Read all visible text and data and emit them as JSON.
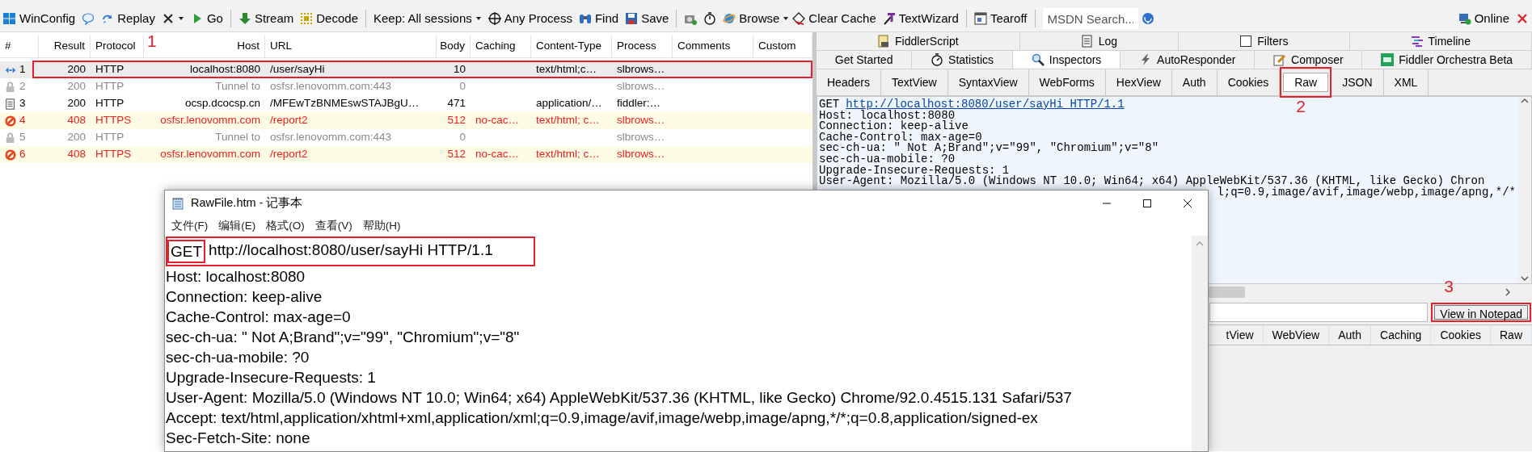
{
  "toolbar": {
    "items": [
      {
        "kind": "button",
        "label": "WinConfig"
      },
      {
        "kind": "icon"
      },
      {
        "kind": "button",
        "label": "Replay"
      },
      {
        "kind": "icon_dropdown"
      },
      {
        "kind": "button",
        "label": "Go"
      },
      {
        "kind": "separator"
      },
      {
        "kind": "button",
        "label": "Stream"
      },
      {
        "kind": "button",
        "label": "Decode"
      },
      {
        "kind": "separator"
      },
      {
        "kind": "dropdown",
        "label": "Keep: All sessions"
      },
      {
        "kind": "button",
        "label": "Any Process"
      },
      {
        "kind": "button",
        "label": "Find"
      },
      {
        "kind": "button",
        "label": "Save"
      },
      {
        "kind": "separator"
      },
      {
        "kind": "icon"
      },
      {
        "kind": "icon"
      },
      {
        "kind": "button_dropdown",
        "label": "Browse"
      },
      {
        "kind": "button",
        "label": "Clear Cache"
      },
      {
        "kind": "button",
        "label": "TextWizard"
      },
      {
        "kind": "separator"
      },
      {
        "kind": "button",
        "label": "Tearoff"
      },
      {
        "kind": "separator"
      },
      {
        "kind": "search",
        "placeholder": "MSDN Search..."
      },
      {
        "kind": "icon"
      },
      {
        "kind": "status",
        "label": "Online"
      },
      {
        "kind": "close"
      }
    ]
  },
  "sessions": {
    "columns": [
      "#",
      "Result",
      "Protocol",
      "Host",
      "URL",
      "Body",
      "Caching",
      "Content-Type",
      "Process",
      "Comments",
      "Custom"
    ],
    "rows": [
      {
        "kind": "request",
        "selected": true,
        "annotated": true,
        "callout": "1",
        "number": "1",
        "result": "200",
        "protocol": "HTTP",
        "host": "localhost:8080",
        "url": "/user/sayHi",
        "body": "10",
        "content_type": "text/html;c…",
        "process": "slbrows…"
      },
      {
        "kind": "tunnel",
        "selected": false,
        "annotated": false,
        "number": "2",
        "result": "200",
        "protocol": "HTTP",
        "host": "Tunnel to",
        "url": "osfsr.lenovomm.com:443",
        "body": "0",
        "process": "slbrows…"
      },
      {
        "kind": "document",
        "selected": false,
        "annotated": false,
        "number": "3",
        "result": "200",
        "protocol": "HTTP",
        "host": "ocsp.dcocsp.cn",
        "url": "/MFEwTzBNMEswSTAJBgU…",
        "body": "471",
        "content_type": "application/…",
        "process": "fiddler:…"
      },
      {
        "kind": "error",
        "selected": false,
        "annotated": false,
        "number": "4",
        "result": "408",
        "protocol": "HTTPS",
        "host": "osfsr.lenovomm.com",
        "url": "/report2",
        "body": "512",
        "caching": "no-cac…",
        "content_type": "text/html; c…",
        "process": "slbrows…"
      },
      {
        "kind": "tunnel",
        "selected": false,
        "annotated": false,
        "number": "5",
        "result": "200",
        "protocol": "HTTP",
        "host": "Tunnel to",
        "url": "osfsr.lenovomm.com:443",
        "body": "0",
        "process": "slbrows…"
      },
      {
        "kind": "error",
        "selected": false,
        "annotated": false,
        "number": "6",
        "result": "408",
        "protocol": "HTTPS",
        "host": "osfsr.lenovomm.com",
        "url": "/report2",
        "body": "512",
        "caching": "no-cac…",
        "content_type": "text/html; c…",
        "process": "slbrows…"
      }
    ]
  },
  "inspector": {
    "top_tabs": [
      {
        "label": "FiddlerScript"
      },
      {
        "label": "Log"
      },
      {
        "label": "Filters"
      },
      {
        "label": "Timeline"
      }
    ],
    "main_tabs": [
      {
        "label": "Get Started",
        "selected": false
      },
      {
        "label": "Statistics",
        "selected": false
      },
      {
        "label": "Inspectors",
        "selected": true
      },
      {
        "label": "AutoResponder",
        "selected": false
      },
      {
        "label": "Composer",
        "selected": false
      },
      {
        "label": "Fiddler Orchestra Beta",
        "selected": false
      }
    ],
    "request_tabs": [
      {
        "label": "Headers",
        "selected": false,
        "annotated": false
      },
      {
        "label": "TextView",
        "selected": false,
        "annotated": false
      },
      {
        "label": "SyntaxView",
        "selected": false,
        "annotated": false
      },
      {
        "label": "WebForms",
        "selected": false,
        "annotated": false
      },
      {
        "label": "HexView",
        "selected": false,
        "annotated": false
      },
      {
        "label": "Auth",
        "selected": false,
        "annotated": false
      },
      {
        "label": "Cookies",
        "selected": false,
        "annotated": false
      },
      {
        "label": "Raw",
        "selected": true,
        "annotated": true,
        "callout": "2"
      },
      {
        "label": "JSON",
        "selected": false,
        "annotated": false
      },
      {
        "label": "XML",
        "selected": false,
        "annotated": false
      }
    ],
    "raw": {
      "method": "GET",
      "link": "http://localhost:8080/user/sayHi HTTP/1.1",
      "lines": [
        "Host: localhost:8080",
        "Connection: keep-alive",
        "Cache-Control: max-age=0",
        "sec-ch-ua: \" Not A;Brand\";v=\"99\", \"Chromium\";v=\"8\"",
        "sec-ch-ua-mobile: ?0",
        "Upgrade-Insecure-Requests: 1",
        "User-Agent: Mozilla/5.0 (Windows NT 10.0; Win64; x64) AppleWebKit/537.36 (KHTML, like Gecko) Chron"
      ],
      "partial_line": "l;q=0.9,image/avif,image/webp,image/apng,*/*"
    },
    "view_button": {
      "label": "View in Notepad",
      "annotated": true,
      "callout": "3"
    },
    "response_tabs": [
      {
        "label": "tView"
      },
      {
        "label": "WebView"
      },
      {
        "label": "Auth"
      },
      {
        "label": "Caching"
      },
      {
        "label": "Cookies"
      },
      {
        "label": "Raw"
      }
    ]
  },
  "notepad": {
    "title": "RawFile.htm - 记事本",
    "menu": [
      "文件(F)",
      "编辑(E)",
      "格式(O)",
      "查看(V)",
      "帮助(H)"
    ],
    "request_line": {
      "method": "GET",
      "method_annotated": true,
      "rest": "http://localhost:8080/user/sayHi HTTP/1.1",
      "annotated": true
    },
    "lines": [
      "Host: localhost:8080",
      "Connection: keep-alive",
      "Cache-Control: max-age=0",
      "sec-ch-ua: \" Not A;Brand\";v=\"99\", \"Chromium\";v=\"8\"",
      "sec-ch-ua-mobile: ?0",
      "Upgrade-Insecure-Requests: 1",
      "User-Agent: Mozilla/5.0 (Windows NT 10.0; Win64; x64) AppleWebKit/537.36 (KHTML, like Gecko) Chrome/92.0.4515.131 Safari/537",
      "Accept: text/html,application/xhtml+xml,application/xml;q=0.9,image/avif,image/webp,image/apng,*/*;q=0.8,application/signed-ex",
      "Sec-Fetch-Site: none"
    ]
  }
}
